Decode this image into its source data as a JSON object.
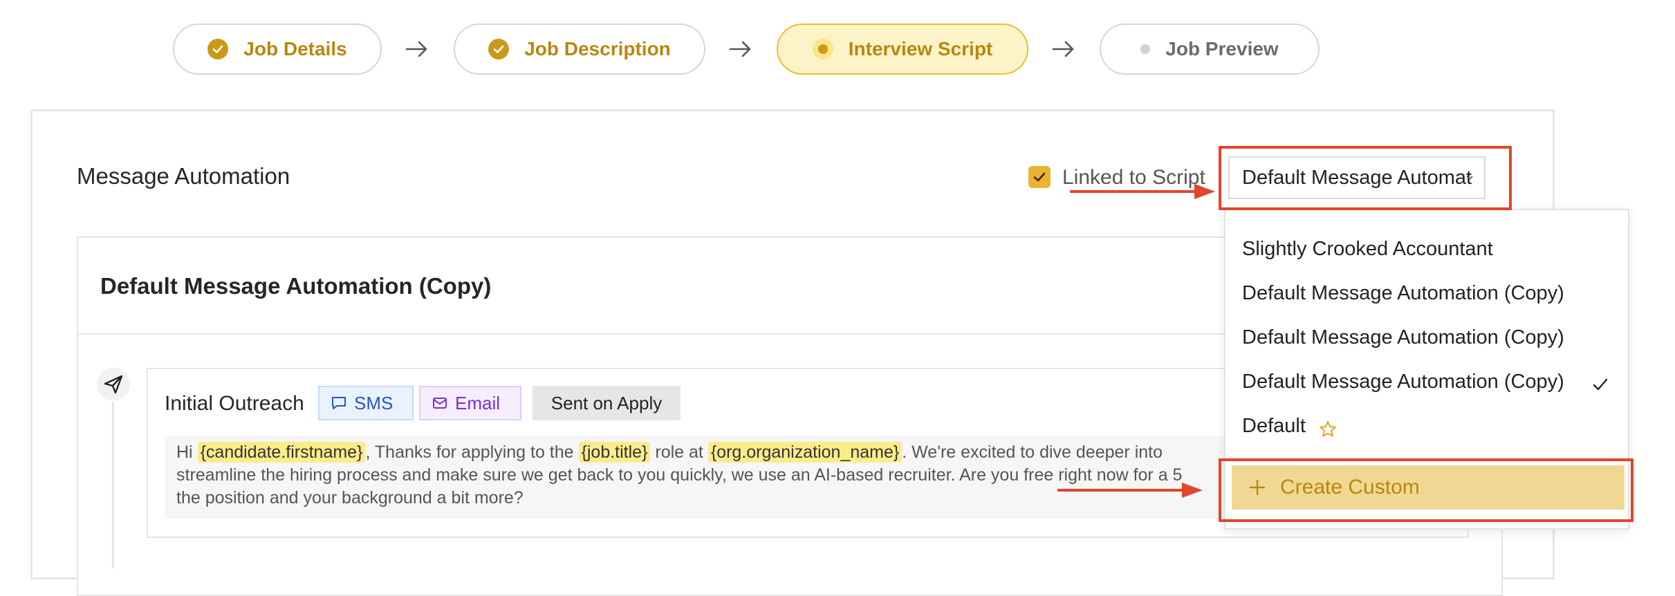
{
  "stepper": {
    "steps": [
      {
        "label": "Job Details",
        "state": "done"
      },
      {
        "label": "Job Description",
        "state": "done"
      },
      {
        "label": "Interview Script",
        "state": "active"
      },
      {
        "label": "Job Preview",
        "state": "pending"
      }
    ]
  },
  "panel": {
    "title": "Message Automation",
    "linked_label": "Linked to Script",
    "linked_checked": true,
    "select_value": "Default Message Automation (Copy)"
  },
  "card": {
    "title": "Default Message Automation (Copy)",
    "outreach": {
      "title": "Initial Outreach",
      "tags": {
        "sms": "SMS",
        "email": "Email",
        "trigger": "Sent on Apply"
      },
      "message": {
        "line1": {
          "p1": "Hi ",
          "v1": "{candidate.firstname}",
          "p2": ", Thanks for applying to the ",
          "v2": "{job.title}",
          "p3": " role at ",
          "v3": "{org.organization_name}",
          "p4": ". We're excited to dive deeper into"
        },
        "line2": "streamline the hiring process and make sure we get back to you quickly, we use an AI-based recruiter. Are you free right now for a 5",
        "line3": "the position and your background a bit more?"
      }
    }
  },
  "dropdown": {
    "items": [
      "Slightly Crooked Accountant",
      "Default Message Automation (Copy)",
      "Default Message Automation (Copy)",
      "Default Message Automation (Copy)",
      "Default"
    ],
    "selected_index": 3,
    "default_icon": "star-icon",
    "create_label": "Create Custom"
  },
  "colors": {
    "accent": "#c99a1a",
    "annotation": "#e2452c",
    "sms": "#2457c5",
    "email": "#7a2fd0",
    "variable_highlight": "#fbec8a"
  }
}
